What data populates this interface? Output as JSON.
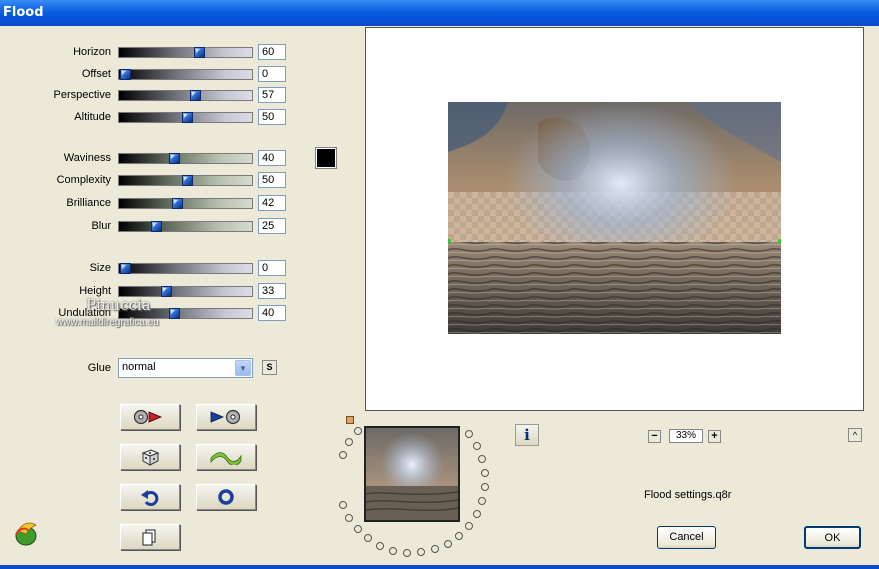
{
  "window": {
    "title": "Flood"
  },
  "params": [
    {
      "label": "Horizon",
      "value": "60",
      "level": 0.6
    },
    {
      "label": "Offset",
      "value": "0",
      "level": 0.0
    },
    {
      "label": "Perspective",
      "value": "57",
      "level": 0.57
    },
    {
      "label": "Altitude",
      "value": "50",
      "level": 0.5
    },
    {
      "label": "Waviness",
      "value": "40",
      "level": 0.4
    },
    {
      "label": "Complexity",
      "value": "50",
      "level": 0.5
    },
    {
      "label": "Brilliance",
      "value": "42",
      "level": 0.42
    },
    {
      "label": "Blur",
      "value": "25",
      "level": 0.25
    },
    {
      "label": "Size",
      "value": "0",
      "level": 0.0
    },
    {
      "label": "Height",
      "value": "33",
      "level": 0.33
    },
    {
      "label": "Undulation",
      "value": "40",
      "level": 0.4
    }
  ],
  "color_swatch": "#000000",
  "glue": {
    "label": "Glue",
    "value": "normal",
    "small_button": "S"
  },
  "zoom": {
    "minus": "−",
    "value": "33%",
    "plus": "+"
  },
  "info_label": "i",
  "top_button": "^",
  "settings_file": "Flood settings.q8r",
  "buttons": {
    "cancel": "Cancel",
    "ok": "OK"
  },
  "watermark": {
    "line1": "Pinuccia",
    "line2": "www.maildiregrafica.eu"
  }
}
